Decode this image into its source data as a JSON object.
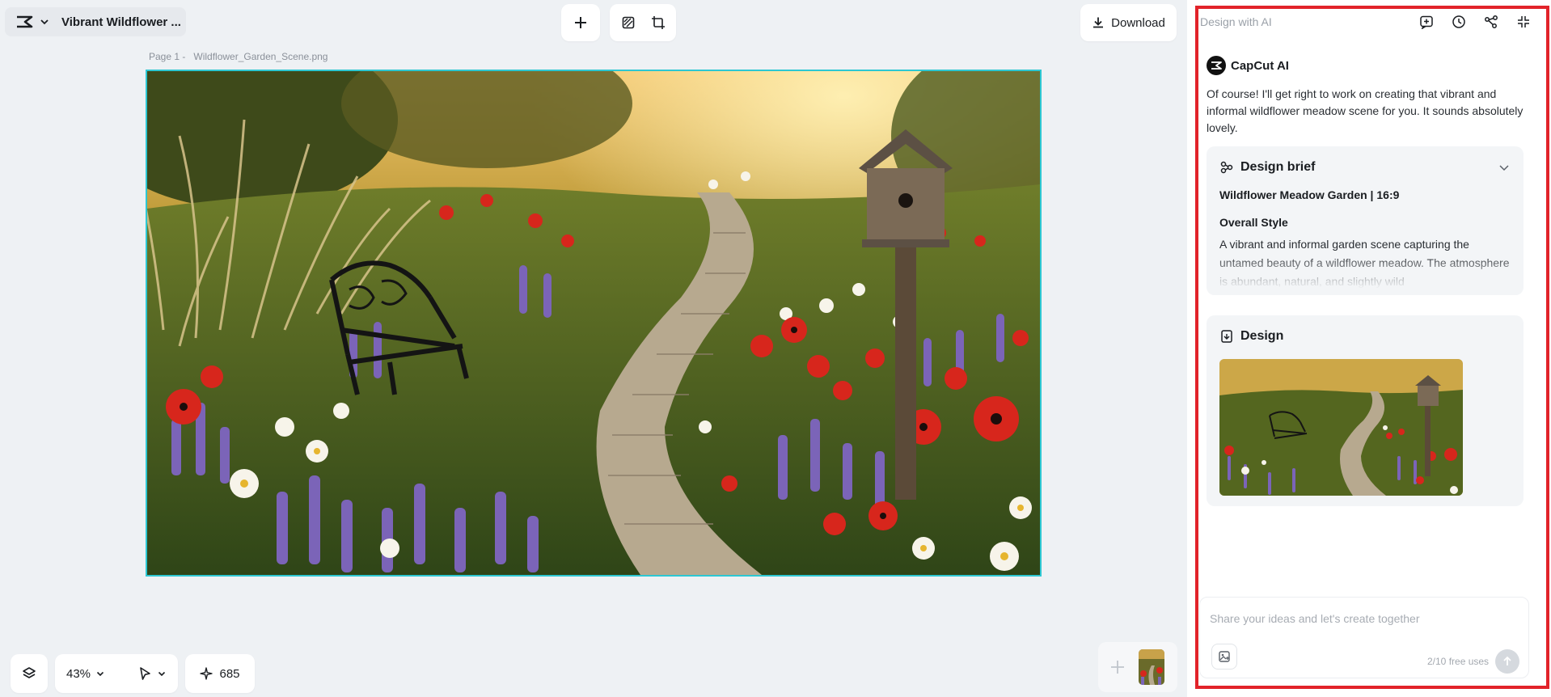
{
  "header": {
    "project_title": "Vibrant Wildflower ...",
    "download_label": "Download"
  },
  "canvas": {
    "page_label": "Page 1 -",
    "file_name": "Wildflower_Garden_Scene.png"
  },
  "controls": {
    "zoom": "43%",
    "credits": "685"
  },
  "panel": {
    "title": "Design with AI",
    "ai_name": "CapCut AI",
    "message": "Of course! I'll get right to work on creating that vibrant and informal wildflower meadow scene for you. It sounds absolutely lovely.",
    "brief": {
      "title": "Design brief",
      "subtitle": "Wildflower Meadow Garden | 16:9",
      "section_title": "Overall Style",
      "section_text": "A vibrant and informal garden scene capturing the untamed beauty of a wildflower meadow. The atmosphere is abundant, natural, and slightly wild"
    },
    "design": {
      "title": "Design"
    },
    "composer": {
      "placeholder": "Share your ideas and let's create together",
      "free_uses": "2/10 free uses"
    }
  },
  "icons": {
    "brand": "capcut-logo-icon",
    "add": "plus-icon",
    "remove_bg": "remove-background-icon",
    "resize": "resize-icon",
    "download": "download-icon",
    "layers": "layers-icon",
    "pointer": "pointer-icon",
    "credits": "sparkle-icon",
    "new_chat": "new-chat-icon",
    "history": "history-icon",
    "share": "share-icon",
    "collapse": "collapse-icon",
    "design_brief": "design-brief-icon",
    "design": "design-icon",
    "attach": "attach-image-icon",
    "send": "send-arrow-icon"
  },
  "colors": {
    "selection_outline": "#2dc7d2",
    "panel_highlight": "#e2232a",
    "poppy_red": "#d7261c",
    "lavender": "#7b64b8"
  }
}
